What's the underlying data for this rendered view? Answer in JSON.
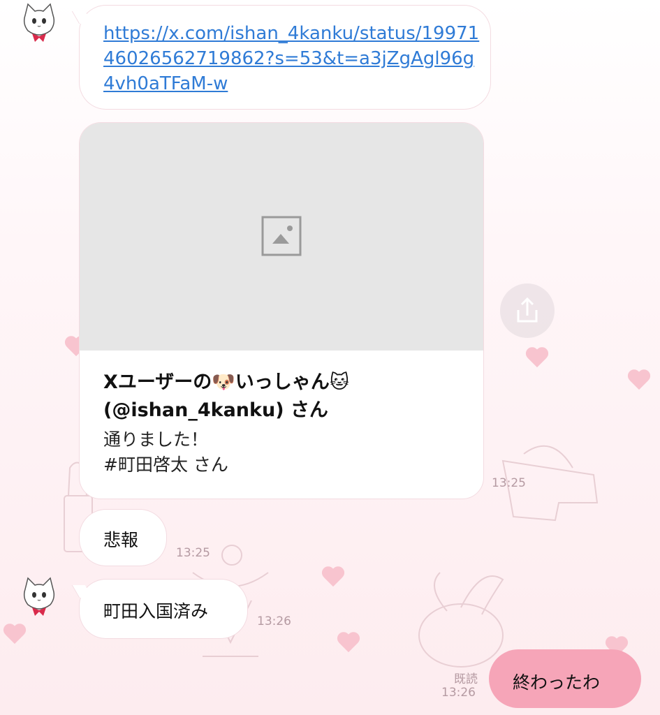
{
  "messages": {
    "link_url": "https://x.com/ishan_4kanku/status/1997146026562719862?s=53&t=a3jZgAgl96g4vh0aTFaM-w",
    "card_title": "Xユーザーの🐶いっしゃん🐱(@ishan_4kanku) さん",
    "card_desc_line1": "通りました！",
    "card_desc_line2": "#町田啓太 さん",
    "card_time": "13:25",
    "msg1_text": "悲報",
    "msg1_time": "13:25",
    "msg2_text": "町田入国済み",
    "msg2_time": "13:26",
    "sent_text": "終わったわ",
    "sent_read": "既読",
    "sent_time": "13:26"
  },
  "icons": {
    "share": "share-icon",
    "image_placeholder": "image-placeholder-icon",
    "avatar": "cat-avatar"
  },
  "colors": {
    "link": "#2f7bd6",
    "sent_bubble": "#f6a5b8",
    "timestamp": "#b59aa2"
  }
}
